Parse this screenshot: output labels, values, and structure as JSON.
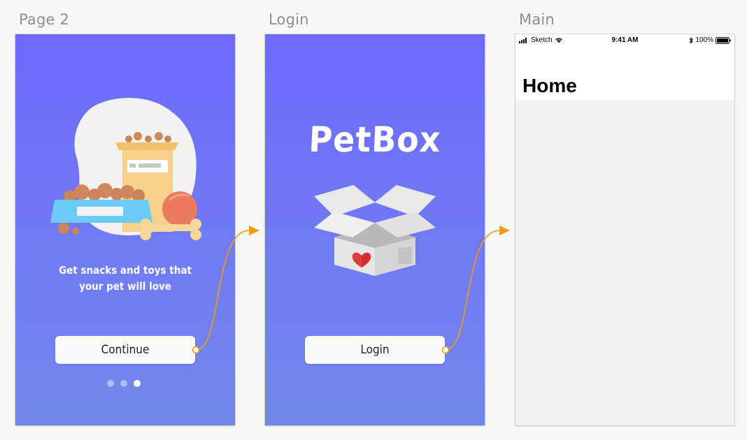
{
  "artboards": [
    {
      "label": "Page 2",
      "tagline": [
        "Get snacks and toys that",
        "your pet will love"
      ],
      "button_label": "Continue",
      "page_dots": {
        "count": 3,
        "active": 3
      }
    },
    {
      "label": "Login",
      "logo_text": "PetBox",
      "button_label": "Login"
    },
    {
      "label": "Main",
      "status_bar": {
        "carrier": "Sketch",
        "time": "9:41 AM",
        "battery": "100%",
        "icons": [
          "signal-icon",
          "wifi-icon",
          "bluetooth-icon",
          "battery-icon"
        ]
      },
      "nav_title": "Home"
    }
  ],
  "colors": {
    "gradient_top": "#6e6afe",
    "gradient_bottom": "#7289ea",
    "link_arrow": "#f39c12",
    "canvas": "#f7f7f7"
  }
}
